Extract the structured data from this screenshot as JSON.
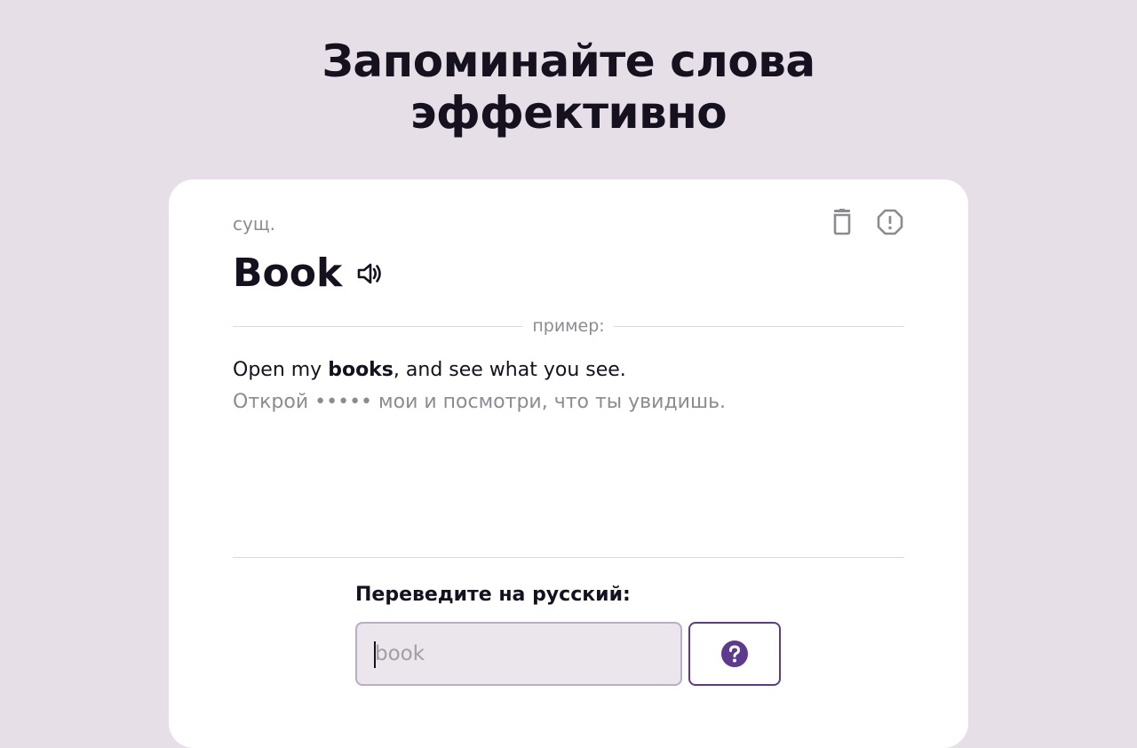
{
  "header": {
    "title_line1": "Запоминайте слова",
    "title_line2": "эффективно"
  },
  "card": {
    "part_of_speech": "сущ.",
    "actions": [
      {
        "icon": "trash-icon",
        "label": "delete"
      },
      {
        "icon": "report-icon",
        "label": "report"
      }
    ],
    "word": "Book",
    "speaker_icon": "speaker-icon",
    "divider_label": "пример:",
    "example": {
      "en_before": "Open my ",
      "en_bold": "books",
      "en_after": ", and see what you see.",
      "ru": "Открой ••••• мои и посмотри, что ты увидишь."
    },
    "prompt": "Переведите на русский:",
    "input": {
      "value": "",
      "placeholder": "book"
    },
    "hint_button_icon": "question-icon"
  },
  "colors": {
    "background": "#e6dfe7",
    "card": "#ffffff",
    "accent": "#5b3a8f",
    "text_primary": "#15111f",
    "text_muted": "#8d8a93"
  }
}
